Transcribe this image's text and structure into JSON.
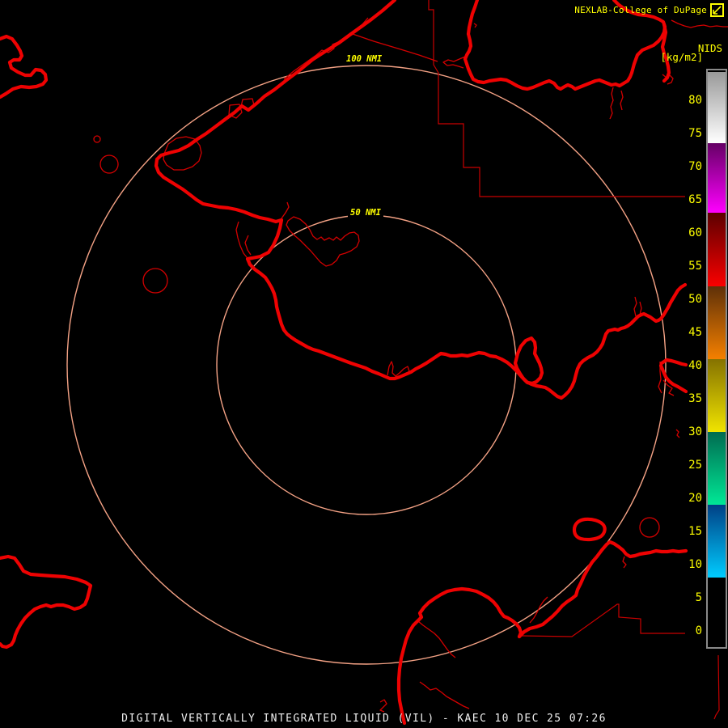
{
  "header": {
    "title": "NEXLAB-College of DuPage",
    "logo_icon": "college-of-dupage-logo"
  },
  "scale": {
    "product": "NIDS",
    "units": "[kg/m2]",
    "tick_values": [
      80,
      75,
      70,
      65,
      60,
      55,
      50,
      45,
      40,
      35,
      30,
      25,
      20,
      15,
      10,
      5,
      0
    ],
    "segments": [
      {
        "min": 8,
        "max": 19,
        "color_bottom": "#00ccff",
        "color_top": "#004085"
      },
      {
        "min": 19,
        "max": 30,
        "color_bottom": "#00e896",
        "color_top": "#006b50"
      },
      {
        "min": 30,
        "max": 41,
        "color_bottom": "#f0e400",
        "color_top": "#857200"
      },
      {
        "min": 41,
        "max": 52,
        "color_bottom": "#f58000",
        "color_top": "#5e3008"
      },
      {
        "min": 52,
        "max": 63,
        "color_bottom": "#fa0000",
        "color_top": "#5c0000"
      },
      {
        "min": 63,
        "max": 73.5,
        "color_bottom": "#ff00ff",
        "color_top": "#650065"
      },
      {
        "min": 73.5,
        "max": 84.3,
        "color_bottom": "#ffffff",
        "color_top": "#999999"
      }
    ]
  },
  "range_rings": {
    "outer_label": "100 NMI",
    "inner_label": "50 NMI"
  },
  "footer": {
    "title": "DIGITAL VERTICALLY INTEGRATED LIQUID (VIL) - KAEC 10 DEC 25 07:26"
  },
  "colors": {
    "background": "#000000",
    "coastline_red": "#ee0202",
    "boundary_red": "#c80000",
    "range_ring": "#f4a285",
    "label_yellow": "#ffff00",
    "footer_text": "#f0f0f0",
    "bar_border": "#8a8a8a"
  }
}
